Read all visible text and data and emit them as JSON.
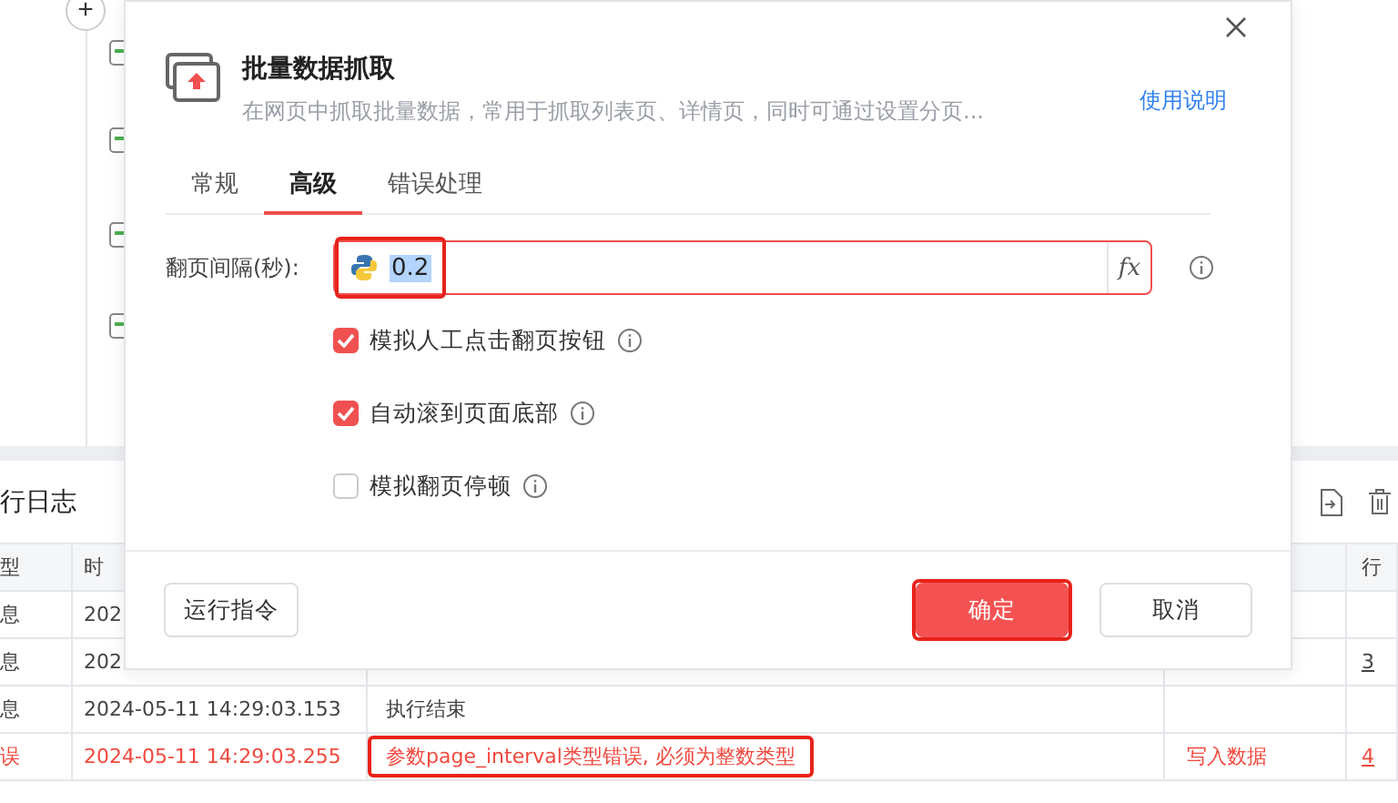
{
  "tree": {
    "add_button": "+"
  },
  "log": {
    "title": "行日志",
    "header": {
      "column_1": "型",
      "column_2": "时",
      "column_5": "行"
    },
    "rows": [
      {
        "kind": "info",
        "column_1": "息",
        "column_2": "202"
      },
      {
        "kind": "info",
        "column_1": "息",
        "column_2": "202",
        "column_5": "3"
      },
      {
        "kind": "info",
        "column_1": "息",
        "column_2": "2024-05-11 14:29:03.153",
        "column_3": "执行结束"
      },
      {
        "kind": "error",
        "column_1": "误",
        "column_2": "2024-05-11 14:29:03.255",
        "column_3": "参数page_interval类型错误, 必须为整数类型",
        "column_3_annotated": true,
        "column_4": "写入数据",
        "column_5": "4"
      }
    ]
  },
  "dialog": {
    "title": "批量数据抓取",
    "description": "在网页中抓取批量数据，常用于抓取列表页、详情页，同时可通过设置分页...",
    "help_link": "使用说明",
    "tabs": [
      {
        "label": "常规",
        "selected": false
      },
      {
        "label": "高级",
        "selected": true
      },
      {
        "label": "错误处理",
        "selected": false
      }
    ],
    "interval": {
      "label": "翻页间隔(秒):",
      "value": "0.2",
      "value_selected": true,
      "annotated": true,
      "fx": "fx"
    },
    "options": [
      {
        "label": "模拟人工点击翻页按钮",
        "checked": true
      },
      {
        "label": "自动滚到页面底部",
        "checked": true
      },
      {
        "label": "模拟翻页停顿",
        "checked": false
      }
    ],
    "buttons": {
      "run": "运行指令",
      "ok": "确定",
      "ok_annotated": true,
      "cancel": "取消"
    }
  }
}
